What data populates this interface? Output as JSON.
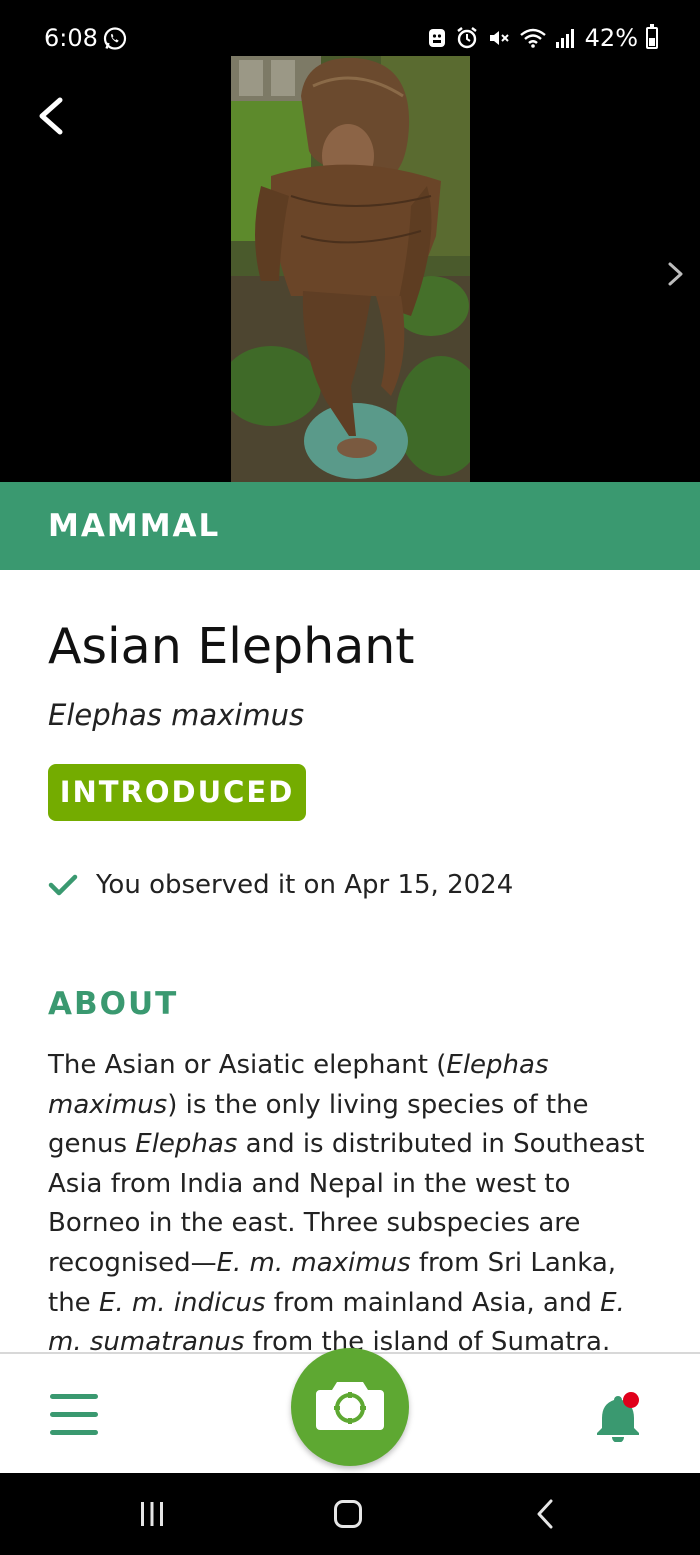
{
  "status_bar": {
    "time": "6:08",
    "battery": "42%",
    "battery_level": 0.42
  },
  "category": {
    "label": "MAMMAL"
  },
  "species": {
    "common_name": "Asian Elephant",
    "scientific_name": "Elephas maximus",
    "status_badge": "INTRODUCED",
    "observed_text": "You observed it on Apr 15, 2024"
  },
  "about": {
    "heading": "ABOUT",
    "segments": [
      {
        "text": "The Asian or Asiatic elephant (",
        "italic": false
      },
      {
        "text": "Elephas maximus",
        "italic": true
      },
      {
        "text": ") is the only living species of the genus ",
        "italic": false
      },
      {
        "text": "Elephas",
        "italic": true
      },
      {
        "text": " and is distributed in Southeast Asia from India and Nepal in the west to Borneo in the east. Three subspecies are recognised—",
        "italic": false
      },
      {
        "text": "E. m. maximus",
        "italic": true
      },
      {
        "text": " from Sri Lanka, the ",
        "italic": false
      },
      {
        "text": "E. m. indicus",
        "italic": true
      },
      {
        "text": " from mainland Asia, and ",
        "italic": false
      },
      {
        "text": "E. m. sumatranus",
        "italic": true
      },
      {
        "text": " from the island of Sumatra.",
        "italic": false
      }
    ]
  },
  "colors": {
    "brand_green": "#3a9970",
    "badge_green": "#74ac00",
    "camera_green": "#5ea832",
    "notification_dot": "#e0001b"
  },
  "icons": {
    "back": "back-arrow-icon",
    "next": "chevron-right-icon",
    "check": "check-icon",
    "menu": "hamburger-menu-icon",
    "camera": "camera-icon",
    "bell": "bell-icon"
  }
}
